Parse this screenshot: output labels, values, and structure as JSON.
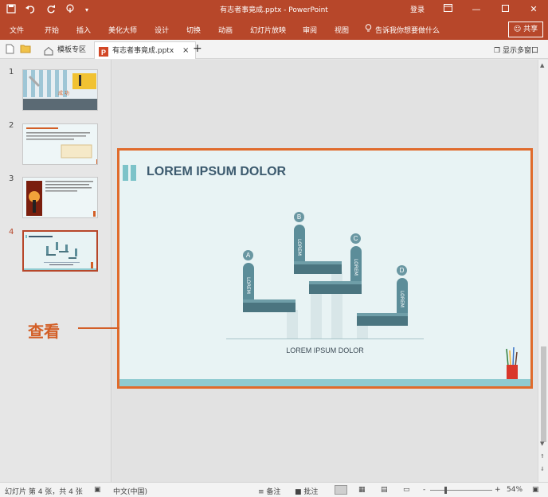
{
  "app": {
    "title": "有志者事竟成.pptx  -  PowerPoint",
    "login_label": "登录",
    "qat": [
      "save-icon",
      "undo-icon",
      "redo-icon",
      "touch-mode-icon",
      "customize-icon"
    ],
    "window_buttons": [
      "ribbon-display-icon",
      "minimize-icon",
      "maximize-icon",
      "close-icon"
    ],
    "accent": "#b7472a"
  },
  "ribbon": {
    "tabs": [
      "文件",
      "开始",
      "插入",
      "美化大师",
      "设计",
      "切换",
      "动画",
      "幻灯片放映",
      "审阅",
      "视图"
    ],
    "tell_me": "告诉我你想要做什么",
    "share": "共享"
  },
  "tabstrip": {
    "tabs": [
      {
        "label": "模板专区",
        "active": false
      },
      {
        "label": "有志者事竟成.pptx",
        "active": true,
        "close": "×"
      }
    ],
    "add_tab": "+",
    "multi_window": "显示多窗口"
  },
  "thumbnails": [
    {
      "number": "1",
      "active": false
    },
    {
      "number": "2",
      "active": false
    },
    {
      "number": "3",
      "active": false
    },
    {
      "number": "4",
      "active": true
    }
  ],
  "slide": {
    "title": "LOREM IPSUM DOLOR",
    "caption": "LOREM IPSUM DOLOR",
    "markers": [
      "A",
      "B",
      "C",
      "D"
    ],
    "arm_labels": [
      "LOREM",
      "LOREM",
      "LOREM",
      "LOREM"
    ]
  },
  "annotation": {
    "text": "查看",
    "color": "#d35f27"
  },
  "statusbar": {
    "slide_info": "幻灯片 第 4 张，共 4 张",
    "language": "中文(中国)",
    "notes": "备注",
    "comments": "批注",
    "zoom": "54%",
    "zoom_minus": "-",
    "zoom_plus": "+"
  }
}
